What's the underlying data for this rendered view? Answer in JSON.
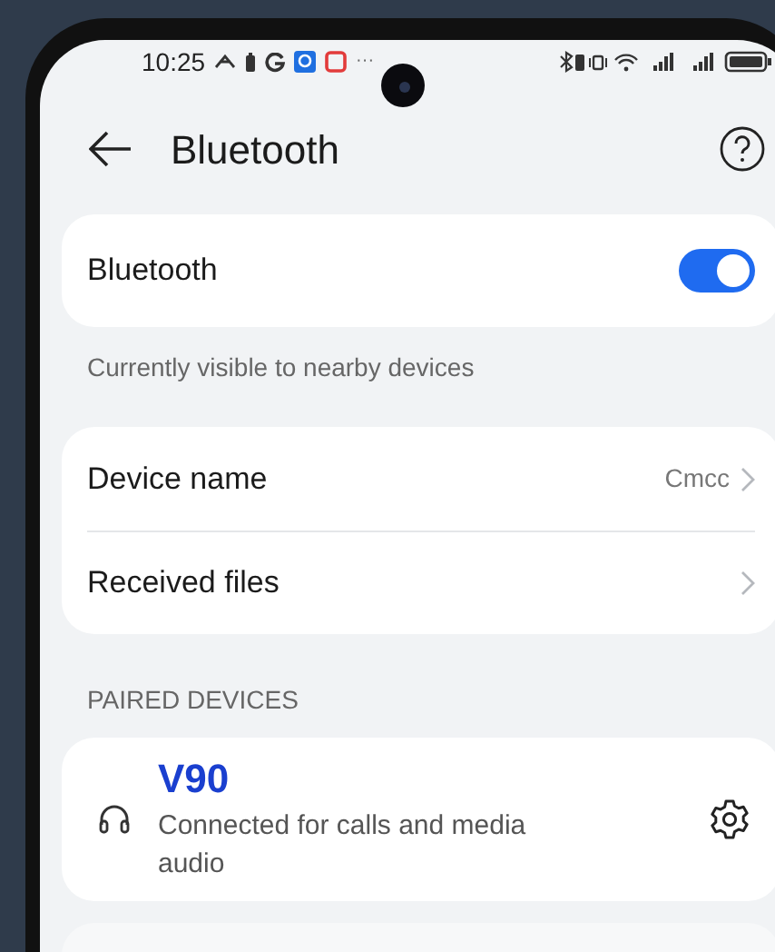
{
  "status_bar": {
    "time": "10:25",
    "notification_more": "···"
  },
  "header": {
    "title": "Bluetooth"
  },
  "bluetooth": {
    "label": "Bluetooth",
    "on": true,
    "caption": "Currently visible to nearby devices"
  },
  "settings": [
    {
      "label": "Device name",
      "value": "Cmcc"
    },
    {
      "label": "Received files"
    }
  ],
  "paired_devices": {
    "heading": "PAIRED DEVICES",
    "devices": [
      {
        "name": "V90",
        "status": "Connected for calls and media audio"
      }
    ]
  }
}
